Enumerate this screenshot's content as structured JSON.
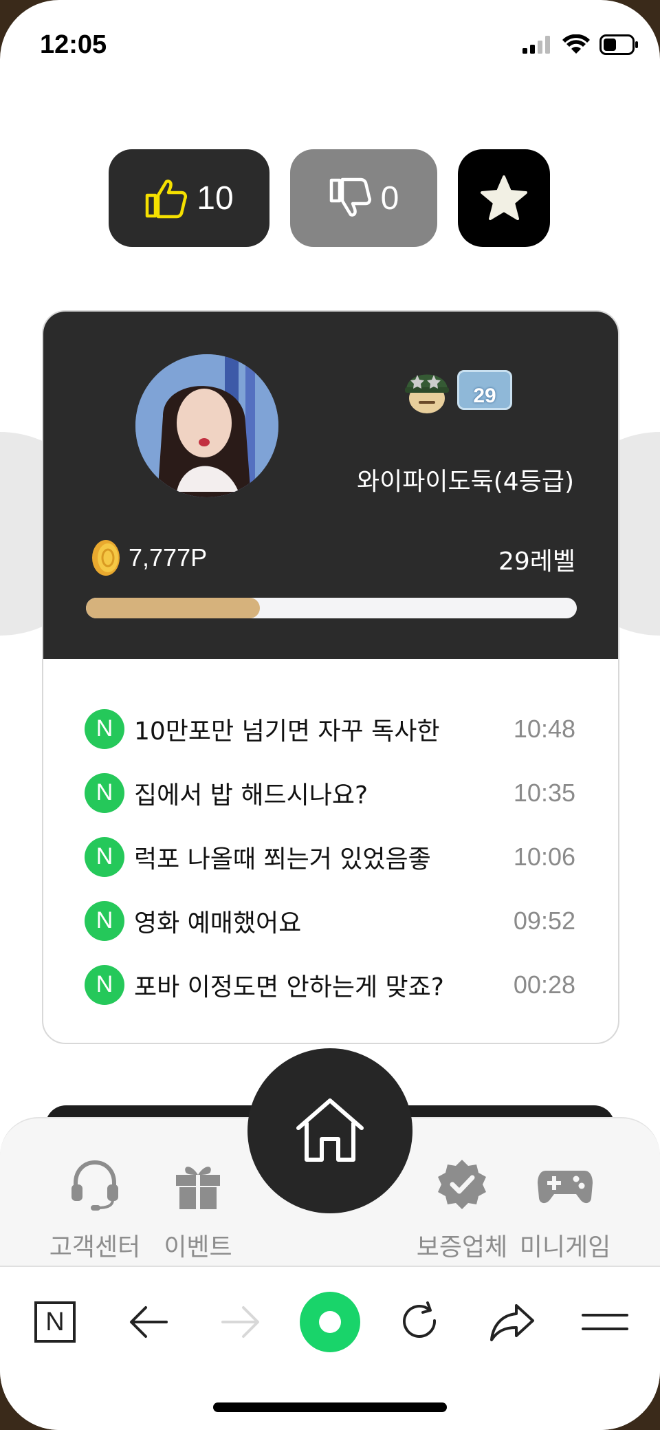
{
  "status_bar": {
    "time": "12:05"
  },
  "reactions": {
    "like_count": "10",
    "dislike_count": "0"
  },
  "profile": {
    "level_badge": "29",
    "nickname": "와이파이도둑(4등급)",
    "points": "7,777P",
    "level_text": "29레벨",
    "progress_fraction": 0.355
  },
  "posts": [
    {
      "badge": "N",
      "title": "10만포만 넘기면 자꾸 독사한",
      "time": "10:48"
    },
    {
      "badge": "N",
      "title": "집에서 밥 해드시나요?",
      "time": "10:35"
    },
    {
      "badge": "N",
      "title": "럭포 나올때 쬐는거 있었음좋",
      "time": "10:06"
    },
    {
      "badge": "N",
      "title": "영화 예매했어요",
      "time": "09:52"
    },
    {
      "badge": "N",
      "title": "포바 이정도면 안하는게 맞죠?",
      "time": "00:28"
    }
  ],
  "bottom_nav": {
    "items": [
      {
        "label": "고객센터",
        "icon": "headset-icon"
      },
      {
        "label": "이벤트",
        "icon": "gift-icon"
      },
      {
        "label": "보증업체",
        "icon": "verified-badge-icon"
      },
      {
        "label": "미니게임",
        "icon": "gamepad-icon"
      }
    ]
  },
  "browser_toolbar": {
    "n_logo": "N"
  },
  "colors": {
    "dark": "#2b2b2b",
    "accent_green": "#25c85a",
    "gold": "#d6b27c",
    "like_yellow": "#f5e000"
  }
}
